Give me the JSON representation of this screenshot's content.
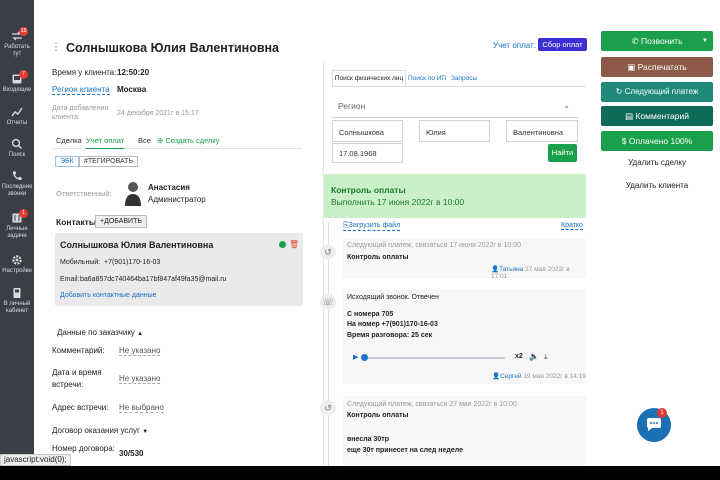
{
  "sidebar": {
    "items": [
      {
        "label": "Работать тут",
        "badge": "18",
        "icon": "arrows-icon"
      },
      {
        "label": "Входящие",
        "badge": "7",
        "icon": "inbox-icon"
      },
      {
        "label": "Отчеты",
        "badge": "",
        "icon": "chart-icon"
      },
      {
        "label": "Поиск",
        "badge": "",
        "icon": "search-icon"
      },
      {
        "label": "Последние звонки",
        "badge": "",
        "icon": "phone-icon"
      },
      {
        "label": "Личные задачи",
        "badge": "1",
        "icon": "tasks-icon"
      },
      {
        "label": "Настройки",
        "badge": "",
        "icon": "gear-icon"
      },
      {
        "label": "В личный кабинет",
        "badge": "",
        "icon": "cabinet-icon"
      }
    ]
  },
  "header": {
    "name": "Солнышкова Юлия Валентиновна",
    "accounting_link": "Учет оплат:",
    "collect_button": "Сбор оплат"
  },
  "client_info": {
    "time_label": "Время у клиента:",
    "time_value": "12:50:20",
    "region_label": "Регион клиента",
    "region_value": "Москва",
    "added_label": "Дата добавления клиента:",
    "added_value": "24 декабря 2021г в 15:17"
  },
  "tabs": [
    "Сделка",
    "Учет оплат",
    "Все"
  ],
  "create_deal": "Создать сделку",
  "tags": [
    "ЭБК",
    "#ТЕГИРОВАТЬ"
  ],
  "responsible": {
    "label": "Ответственный:",
    "name": "Анастасия",
    "role": "Администратор"
  },
  "contacts": {
    "title": "Контакты",
    "add_button": "ДОБАВИТЬ",
    "contact_name": "Солнышкова Юлия Валентиновна",
    "mobile_label": "Мобильный:",
    "mobile_value": "+7(901)170-16-03",
    "email_label": "Email:",
    "email_value": "ba6a857dc740464ba17bf847af49fa35@mail.ru",
    "add_data_link": "Добавить контактные данные"
  },
  "customer_data": {
    "title": "Данные по заказчику",
    "rows": [
      {
        "label": "Комментарий:",
        "value": "Не указано"
      },
      {
        "label": "Дата и время встречи:",
        "value": "Не указано"
      },
      {
        "label": "Адрес встречи:",
        "value": "Не выбрано"
      }
    ]
  },
  "contract": {
    "title": "Договор оказания услуг",
    "number_label": "Номер договора:",
    "number_value": "30/530"
  },
  "search_panel": {
    "tabs": [
      "Поиск физических лиц",
      "Поиск по ИП",
      "Запросы"
    ],
    "region_placeholder": "Регион",
    "surname": "Солнышкова",
    "first_name": "Юлия",
    "patronymic": "Валентиновна",
    "birthdate": "17.08.1968",
    "find_button": "Найти"
  },
  "payment_control": {
    "title": "Контроль оплаты",
    "subtitle": "Выполнить 17 июня 2022г в 10:00"
  },
  "timeline": {
    "upload_link": "Загрузить файл",
    "brief_link": "Кратко",
    "entries": [
      {
        "head": "Следующий платеж, связаться 17 июня 2022г в 10:00",
        "body": "Контроль оплаты",
        "author": "Татьяна",
        "date": "27 мая 2022г в 17:01"
      },
      {
        "head": "Исходящий звонок. Отвечен",
        "line1": "С номера 705",
        "line2": "На номер +7(901)170-16-03",
        "line3": "Время разговора: 25 сек",
        "speed": "x2",
        "author": "Сергей",
        "date": "19 мая 2022г в 14:19"
      },
      {
        "head": "Следующий платеж, связаться 27 мая 2022г в 10:00",
        "body": "Контроль оплаты",
        "line1": "внесла 30тр",
        "line2": "еще 30т принесет на след неделе"
      }
    ]
  },
  "actions": {
    "call": "Позвонить",
    "print": "Распечатать",
    "next_payment": "Следующий платеж",
    "comment": "Комментарий",
    "paid": "Оплачено 100%",
    "delete_deal": "Удалить сделку",
    "delete_client": "Удалить клиента"
  },
  "chat_badge": "1",
  "status_bar": "javascript:void(0);"
}
